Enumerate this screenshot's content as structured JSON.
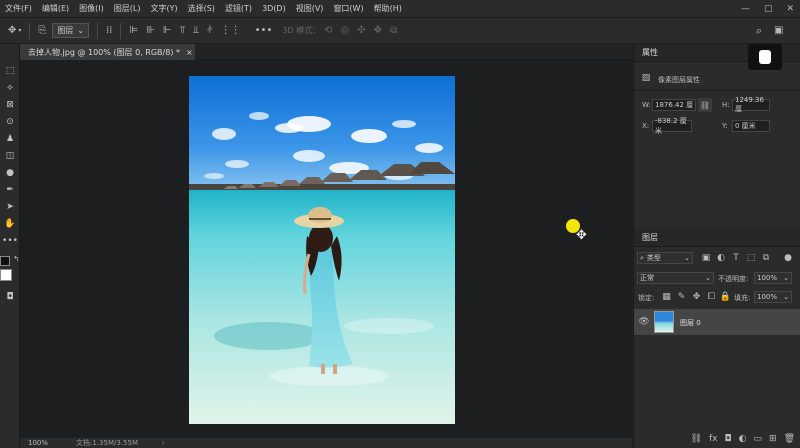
{
  "menu": [
    "文件(F)",
    "编辑(E)",
    "图像(I)",
    "图层(L)",
    "文字(Y)",
    "选择(S)",
    "滤镜(T)",
    "3D(D)",
    "视图(V)",
    "窗口(W)",
    "帮助(H)"
  ],
  "window_controls": {
    "minimize": "—",
    "maximize": "▢",
    "close": "✕"
  },
  "options": {
    "sample": "图层",
    "mode_3d": "3D 模式："
  },
  "document": {
    "tab_title": "去掉人物.jpg @ 100% (图层 0, RGB/8) *",
    "close": "×",
    "zoom": "100%",
    "doc_info": "文档:1.35M/3.55M"
  },
  "properties": {
    "title": "属性",
    "subtitle": "像素图层属性",
    "w_label": "W:",
    "w_value": "1876.42 厘",
    "h_label": "H:",
    "h_value": "1249.36 厘",
    "x_label": "X:",
    "x_value": "-838.2 厘米",
    "y_label": "Y:",
    "y_value": "0 厘米"
  },
  "layers": {
    "title": "图层",
    "filter_kind": "类型",
    "blend_mode": "正常",
    "opacity_label": "不透明度:",
    "opacity_value": "100%",
    "lock_label": "锁定:",
    "fill_label": "填充:",
    "fill_value": "100%",
    "items": [
      {
        "name": "图层 0",
        "visible": true
      }
    ]
  },
  "colors": {
    "accent": "#31a8ff",
    "bg": "#1d1e20",
    "panel": "#2b2b2b",
    "cursor": "#f2e600"
  }
}
